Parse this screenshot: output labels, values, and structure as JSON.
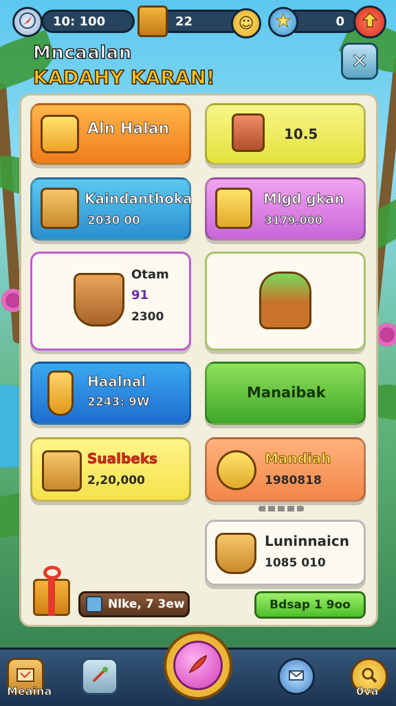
{
  "hud": {
    "time": "10: 100",
    "coins": "22",
    "gems": "0",
    "smiley": "☺"
  },
  "title": {
    "line1": "Mncaalan",
    "line2": "KADAHY KARAN!",
    "close": "✕"
  },
  "cards": [
    {
      "name": "Aln Halan",
      "value": ""
    },
    {
      "name": "",
      "value": "10.5"
    },
    {
      "name": "Kaindanthoka",
      "value": "2030 00"
    },
    {
      "name": "Mlgd gkan",
      "value": "3179.000"
    },
    {
      "name": "Otam",
      "value": "91",
      "value2": "2300"
    },
    {
      "name": "",
      "value": ""
    },
    {
      "name": "Haalnal",
      "value": "2243: 9W"
    },
    {
      "name": "Manaibak",
      "value": ""
    },
    {
      "name": "Sualbeks",
      "value": "2,20,000"
    },
    {
      "name": "Mandiah",
      "value": "1980818"
    },
    {
      "name": "Luninnaicn",
      "value": "1085 010"
    }
  ],
  "bottom": {
    "left_pill": "Nlke, 7 3ew",
    "right_pill": "Bdsap 1 9oo"
  },
  "nav": {
    "left_label": "Meaina",
    "right_label": "0va"
  },
  "colors": {
    "accent_gold": "#ffc21f",
    "panel": "#f3efde",
    "hud_dark": "#26445e"
  }
}
